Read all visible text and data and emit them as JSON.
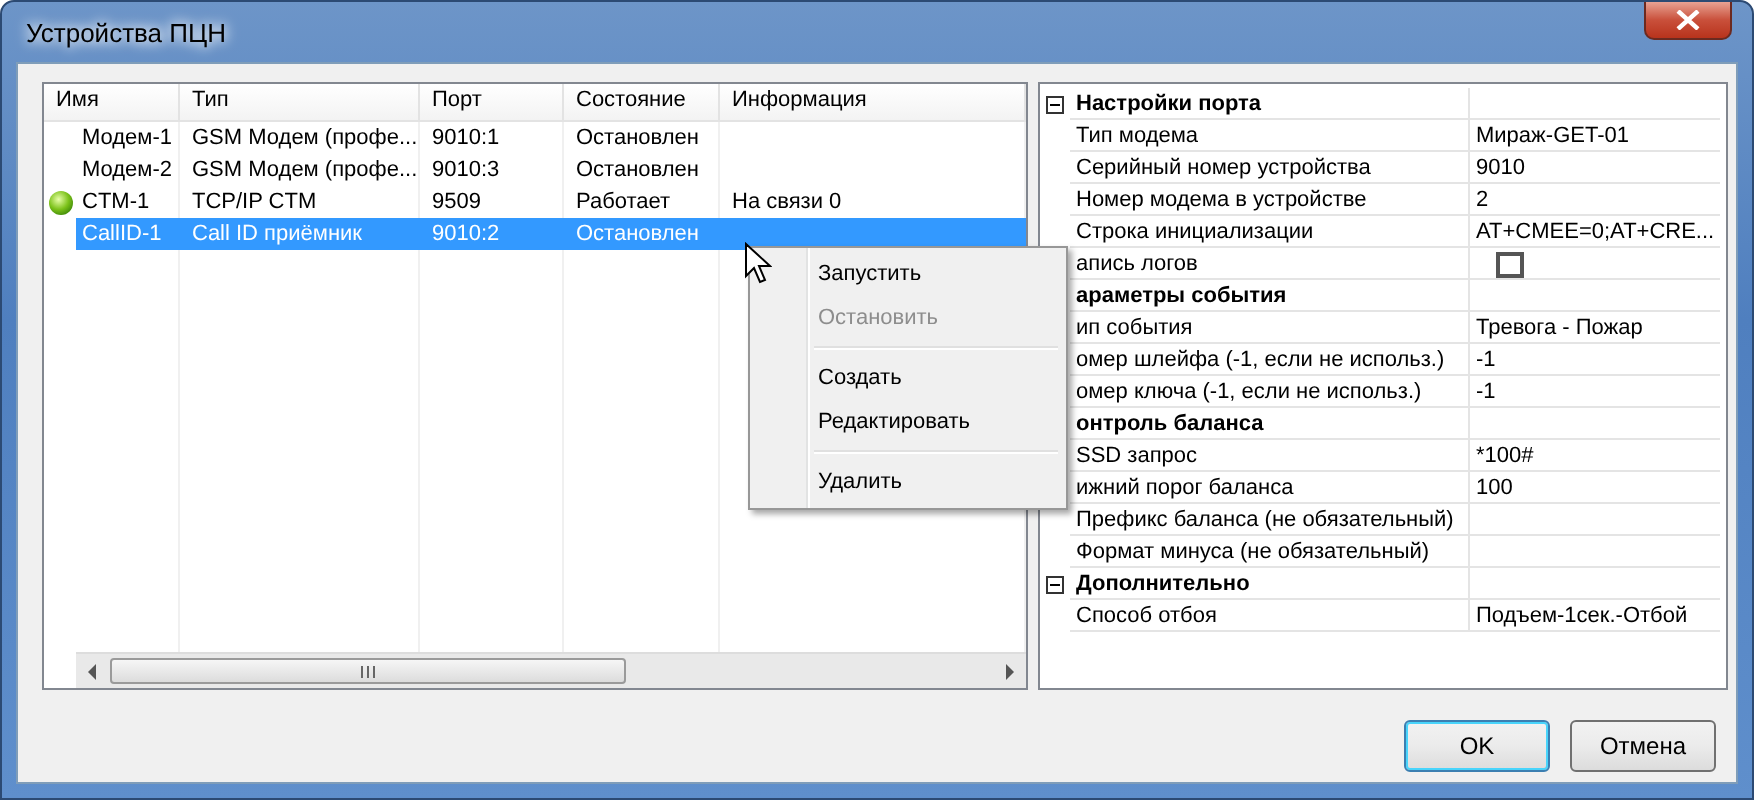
{
  "window": {
    "title": "Устройства ПЦН"
  },
  "devices": {
    "columns": [
      "Имя",
      "Тип",
      "Порт",
      "Состояние",
      "Информация"
    ],
    "rows": [
      {
        "online": false,
        "selected": false,
        "cells": [
          "Модем-1",
          "GSM Модем (профе...",
          "9010:1",
          "Остановлен"
        ]
      },
      {
        "online": false,
        "selected": false,
        "cells": [
          "Модем-2",
          "GSM Модем (профе...",
          "9010:3",
          "Остановлен"
        ]
      },
      {
        "online": true,
        "selected": false,
        "cells": [
          "CTM-1",
          "TCP/IP CTM",
          "9509",
          "Работает",
          "На связи 0"
        ]
      },
      {
        "online": false,
        "selected": true,
        "cells": [
          "CallID-1",
          "Call ID приёмник",
          "9010:2",
          "Остановлен"
        ]
      }
    ]
  },
  "properties": [
    {
      "kind": "section",
      "name": "Настройки порта",
      "expanded": true
    },
    {
      "kind": "text",
      "name": "Тип модема",
      "value": "Мираж-GET-01"
    },
    {
      "kind": "text",
      "name": "Серийный номер устройства",
      "value": "9010"
    },
    {
      "kind": "text",
      "name": "Номер модема в устройстве",
      "value": "2"
    },
    {
      "kind": "text",
      "name": "Строка инициализации",
      "value": "AT+CMEE=0;AT+CRE..."
    },
    {
      "kind": "checkbox",
      "name": "апись логов",
      "checked": false
    },
    {
      "kind": "section",
      "name": "араметры события"
    },
    {
      "kind": "text",
      "name": "ип события",
      "value": "Тревога - Пожар"
    },
    {
      "kind": "text",
      "name": "омер шлейфа (-1, если не использ.)",
      "value": "-1"
    },
    {
      "kind": "text",
      "name": "омер ключа (-1, если не использ.)",
      "value": "-1"
    },
    {
      "kind": "section",
      "name": "онтроль баланса"
    },
    {
      "kind": "text",
      "name": "SSD запрос",
      "value": "*100#"
    },
    {
      "kind": "text",
      "name": "ижний порог баланса",
      "value": "100"
    },
    {
      "kind": "text",
      "name": "Префикс баланса (не обязательный)"
    },
    {
      "kind": "text",
      "name": "Формат минуса (не обязательный)"
    },
    {
      "kind": "section",
      "name": "Дополнительно",
      "expanded": true
    },
    {
      "kind": "text",
      "name": "Способ отбоя",
      "value": "Подъем-1сек.-Отбой"
    }
  ],
  "context_menu": [
    {
      "kind": "item",
      "label": "Запустить",
      "disabled": false
    },
    {
      "kind": "item",
      "label": "Остановить",
      "disabled": true
    },
    {
      "kind": "separator"
    },
    {
      "kind": "item",
      "label": "Создать",
      "disabled": false
    },
    {
      "kind": "item",
      "label": "Редактировать",
      "disabled": false
    },
    {
      "kind": "separator"
    },
    {
      "kind": "item",
      "label": "Удалить",
      "disabled": false
    }
  ],
  "buttons": [
    "OK",
    "Отмена"
  ]
}
